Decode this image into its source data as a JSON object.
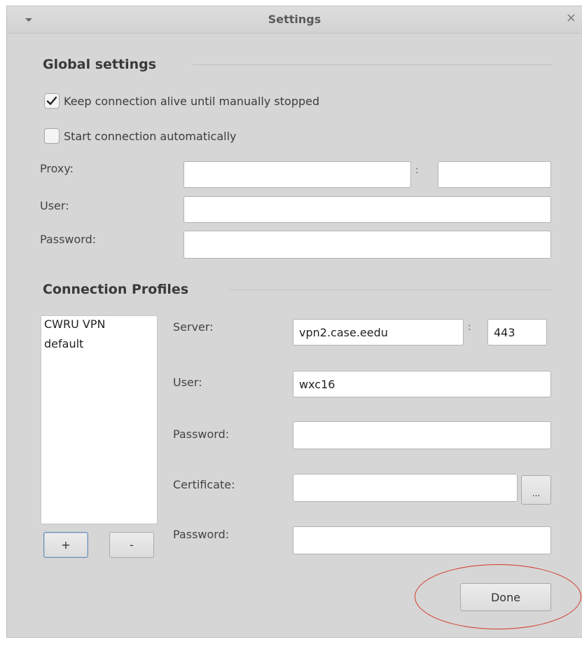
{
  "window": {
    "title": "Settings",
    "close_glyph": "×",
    "menu_icon": "chevron-down-icon"
  },
  "global": {
    "heading": "Global settings",
    "keep_alive": {
      "label": "Keep connection alive until manually stopped",
      "checked": true
    },
    "auto_start": {
      "label": "Start connection automatically",
      "checked": false
    },
    "proxy_label": "Proxy:",
    "proxy_host": "",
    "proxy_port": "",
    "proxy_colon": ":",
    "user_label": "User:",
    "user_value": "",
    "password_label": "Password:",
    "password_value": ""
  },
  "profiles": {
    "heading": "Connection Profiles",
    "list": [
      "CWRU VPN",
      "default"
    ],
    "add_label": "+",
    "remove_label": "-",
    "server_label": "Server:",
    "server_value": "vpn2.case.eedu",
    "server_colon": ":",
    "port_value": "443",
    "user_label": "User:",
    "user_value": "wxc16",
    "password_label": "Password:",
    "password_value": "",
    "certificate_label": "Certificate:",
    "certificate_value": "",
    "browse_label": "...",
    "cert_password_label": "Password:",
    "cert_password_value": ""
  },
  "done_label": "Done",
  "colors": {
    "annotation": "#d23a2a",
    "window_bg": "#d6d6d6"
  }
}
